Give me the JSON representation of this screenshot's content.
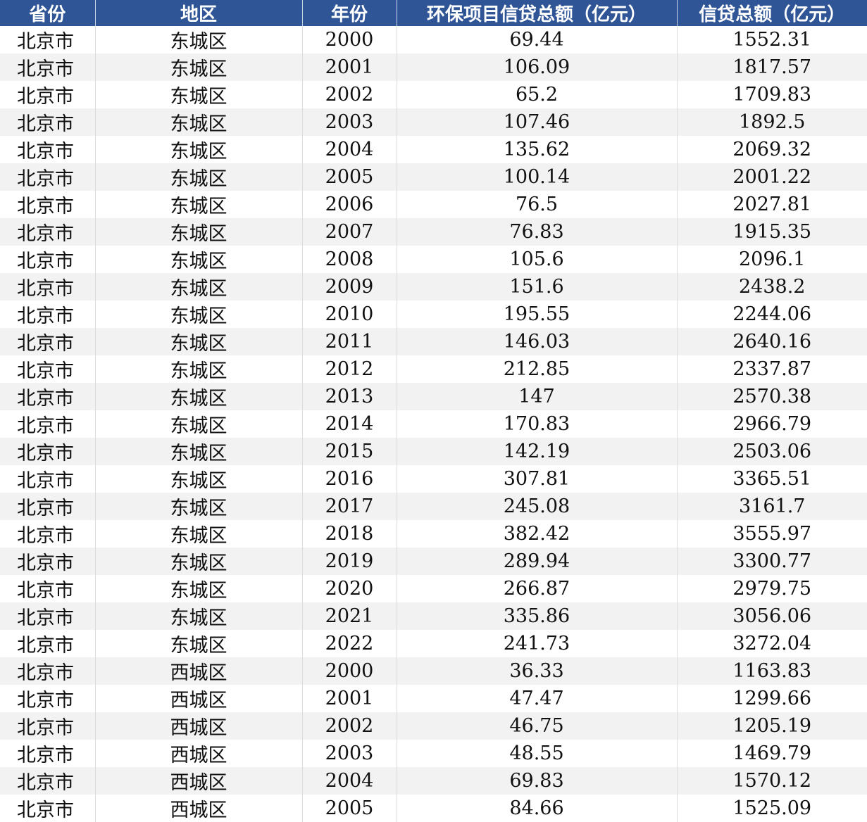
{
  "headers": [
    "省份",
    "地区",
    "年份",
    "环保项目信贷总额（亿元）",
    "信贷总额（亿元）"
  ],
  "rows": [
    [
      "北京市",
      "东城区",
      "2000",
      "69.44",
      "1552.31"
    ],
    [
      "北京市",
      "东城区",
      "2001",
      "106.09",
      "1817.57"
    ],
    [
      "北京市",
      "东城区",
      "2002",
      "65.2",
      "1709.83"
    ],
    [
      "北京市",
      "东城区",
      "2003",
      "107.46",
      "1892.5"
    ],
    [
      "北京市",
      "东城区",
      "2004",
      "135.62",
      "2069.32"
    ],
    [
      "北京市",
      "东城区",
      "2005",
      "100.14",
      "2001.22"
    ],
    [
      "北京市",
      "东城区",
      "2006",
      "76.5",
      "2027.81"
    ],
    [
      "北京市",
      "东城区",
      "2007",
      "76.83",
      "1915.35"
    ],
    [
      "北京市",
      "东城区",
      "2008",
      "105.6",
      "2096.1"
    ],
    [
      "北京市",
      "东城区",
      "2009",
      "151.6",
      "2438.2"
    ],
    [
      "北京市",
      "东城区",
      "2010",
      "195.55",
      "2244.06"
    ],
    [
      "北京市",
      "东城区",
      "2011",
      "146.03",
      "2640.16"
    ],
    [
      "北京市",
      "东城区",
      "2012",
      "212.85",
      "2337.87"
    ],
    [
      "北京市",
      "东城区",
      "2013",
      "147",
      "2570.38"
    ],
    [
      "北京市",
      "东城区",
      "2014",
      "170.83",
      "2966.79"
    ],
    [
      "北京市",
      "东城区",
      "2015",
      "142.19",
      "2503.06"
    ],
    [
      "北京市",
      "东城区",
      "2016",
      "307.81",
      "3365.51"
    ],
    [
      "北京市",
      "东城区",
      "2017",
      "245.08",
      "3161.7"
    ],
    [
      "北京市",
      "东城区",
      "2018",
      "382.42",
      "3555.97"
    ],
    [
      "北京市",
      "东城区",
      "2019",
      "289.94",
      "3300.77"
    ],
    [
      "北京市",
      "东城区",
      "2020",
      "266.87",
      "2979.75"
    ],
    [
      "北京市",
      "东城区",
      "2021",
      "335.86",
      "3056.06"
    ],
    [
      "北京市",
      "东城区",
      "2022",
      "241.73",
      "3272.04"
    ],
    [
      "北京市",
      "西城区",
      "2000",
      "36.33",
      "1163.83"
    ],
    [
      "北京市",
      "西城区",
      "2001",
      "47.47",
      "1299.66"
    ],
    [
      "北京市",
      "西城区",
      "2002",
      "46.75",
      "1205.19"
    ],
    [
      "北京市",
      "西城区",
      "2003",
      "48.55",
      "1469.79"
    ],
    [
      "北京市",
      "西城区",
      "2004",
      "69.83",
      "1570.12"
    ],
    [
      "北京市",
      "西城区",
      "2005",
      "84.66",
      "1525.09"
    ]
  ]
}
